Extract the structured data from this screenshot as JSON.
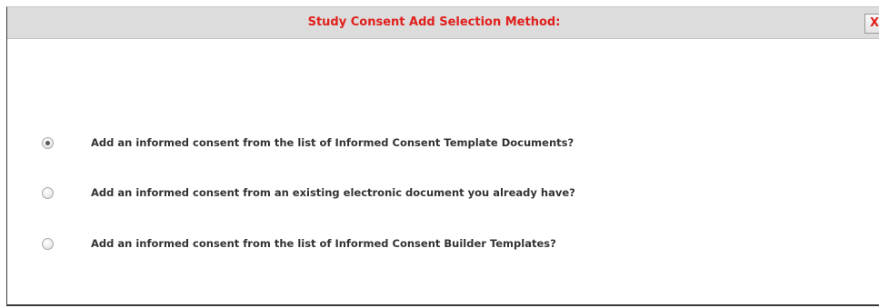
{
  "dialog": {
    "title": "Study Consent Add Selection Method:",
    "close_label": "X"
  },
  "options": [
    {
      "label": "Add an informed consent from the list of Informed Consent Template Documents?",
      "selected": true
    },
    {
      "label": "Add an informed consent from an existing electronic document you already have?",
      "selected": false
    },
    {
      "label": "Add an informed consent from the list of Informed Consent Builder Templates?",
      "selected": false
    }
  ],
  "colors": {
    "title_text": "#e0201c",
    "title_bar_bg": "#dcdcdc",
    "label_text": "#333333"
  }
}
